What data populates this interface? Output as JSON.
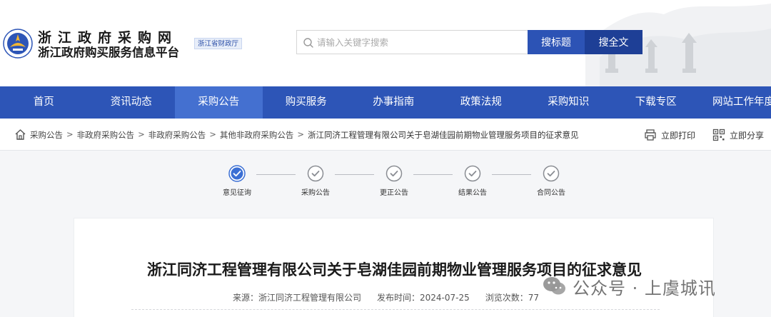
{
  "header": {
    "site_title": "浙江政府采购网",
    "site_subtitle": "浙江政府购买服务信息平台",
    "org_badge": "浙江省财政厅",
    "search": {
      "placeholder": "请输入关键字搜索",
      "btn_title": "搜标题",
      "btn_full": "搜全文"
    }
  },
  "nav": {
    "items": [
      {
        "label": "首页"
      },
      {
        "label": "资讯动态"
      },
      {
        "label": "采购公告"
      },
      {
        "label": "购买服务"
      },
      {
        "label": "办事指南"
      },
      {
        "label": "政策法规"
      },
      {
        "label": "采购知识"
      },
      {
        "label": "下载专区"
      },
      {
        "label": "网站工作年度报"
      }
    ],
    "active_index": 2
  },
  "breadcrumb": {
    "items": [
      "采购公告",
      "非政府采购公告",
      "非政府采购公告",
      "其他非政府采购公告",
      "浙江同济工程管理有限公司关于皂湖佳园前期物业管理服务项目的征求意见"
    ],
    "separator": ">",
    "print_label": "立即打印",
    "share_label": "立即分享"
  },
  "steps": [
    {
      "label": "意见征询",
      "active": true
    },
    {
      "label": "采购公告",
      "active": false
    },
    {
      "label": "更正公告",
      "active": false
    },
    {
      "label": "结果公告",
      "active": false
    },
    {
      "label": "合同公告",
      "active": false
    }
  ],
  "article": {
    "title": "浙江同济工程管理有限公司关于皂湖佳园前期物业管理服务项目的征求意见",
    "source": "来源：浙江同济工程管理有限公司",
    "publish_time": "发布时间：2024-07-25",
    "views": "浏览次数：77"
  },
  "watermark": "公众号 · 上虞城讯",
  "colors": {
    "nav_bg": "#2d55b7",
    "nav_active": "#4470d0",
    "btn_title": "#2c53b5",
    "btn_full": "#1e3f96",
    "step_active": "#3b6fd4",
    "step_inactive": "#8a8d93"
  }
}
